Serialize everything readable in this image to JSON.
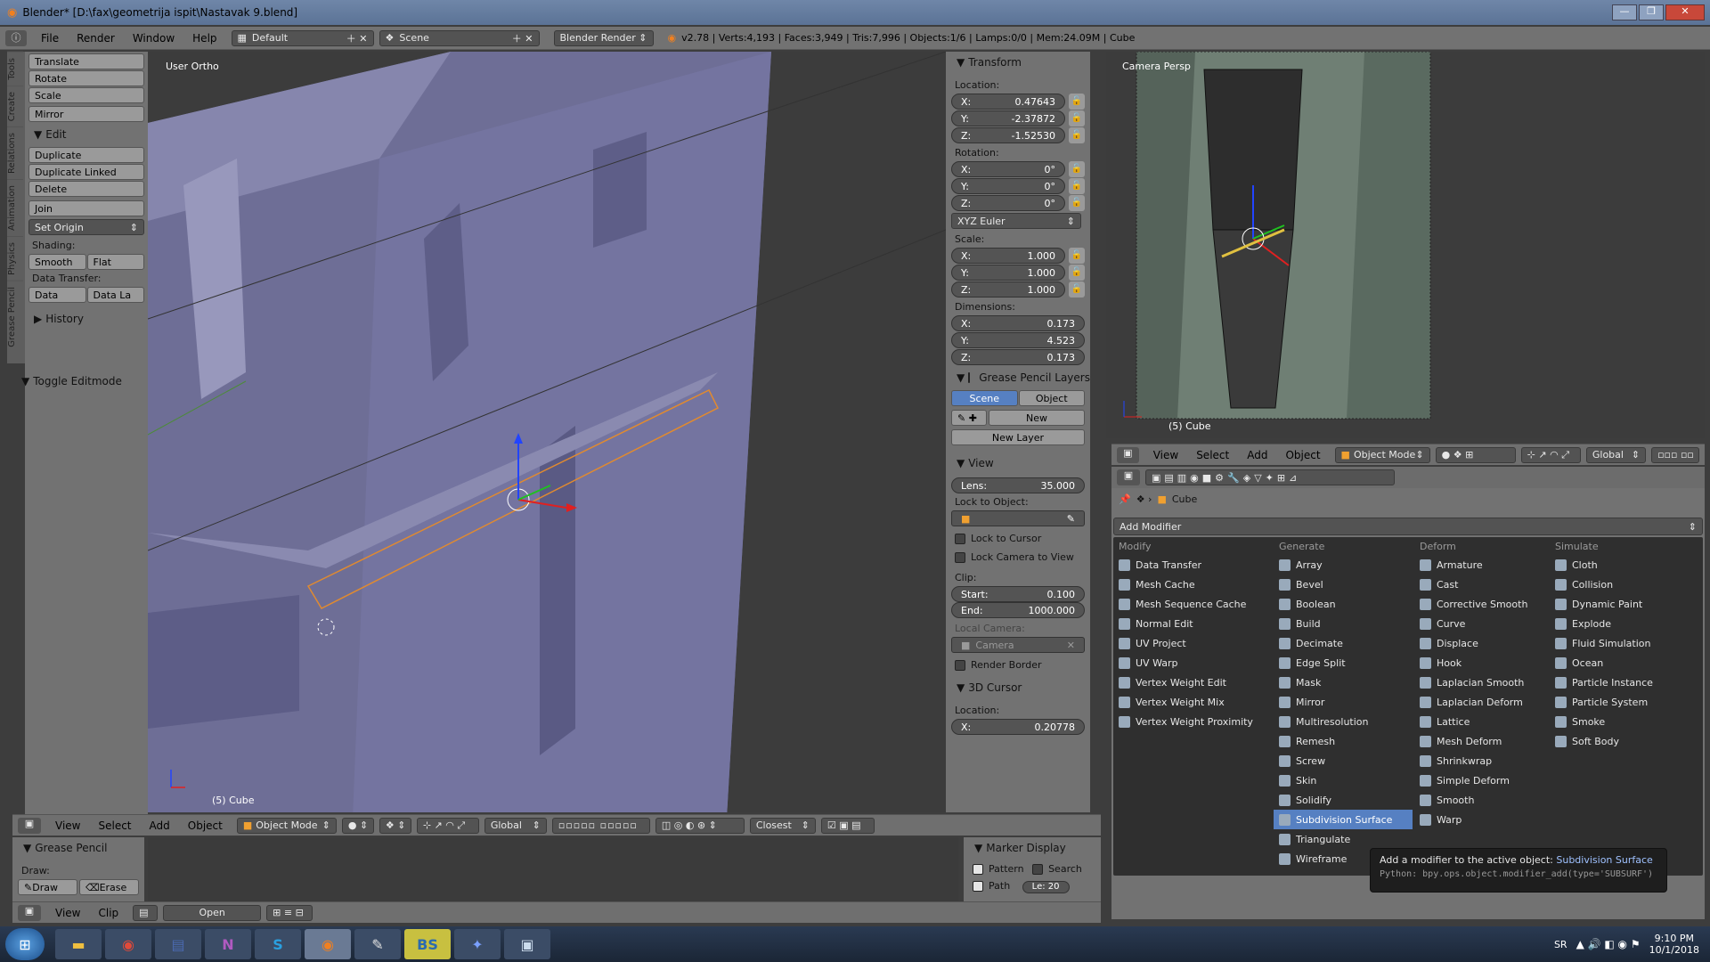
{
  "titlebar": {
    "title": "Blender* [D:\\fax\\geometrija ispit\\Nastavak 9.blend]",
    "min": "—",
    "max": "❐",
    "close": "✕"
  },
  "info": {
    "menus": [
      "File",
      "Render",
      "Window",
      "Help"
    ],
    "layout": "Default",
    "scene": "Scene",
    "engine": "Blender Render",
    "stats": "v2.78 | Verts:4,193 | Faces:3,949 | Tris:7,996 | Objects:1/6 | Lamps:0/0 | Mem:24.09M | Cube"
  },
  "tools": {
    "tabs": [
      "Tools",
      "Create",
      "Relations",
      "Animation",
      "Physics",
      "Grease Pencil"
    ],
    "transform": [
      "Translate",
      "Rotate",
      "Scale"
    ],
    "mirror": "Mirror",
    "edit_title": "Edit",
    "edit": [
      "Duplicate",
      "Duplicate Linked",
      "Delete"
    ],
    "join": "Join",
    "set_origin": "Set Origin",
    "shading_label": "Shading:",
    "smooth": "Smooth",
    "flat": "Flat",
    "data_transfer_label": "Data Transfer:",
    "data": "Data",
    "data_la": "Data La",
    "history": "History",
    "toggle_editmode": "Toggle Editmode"
  },
  "viewport": {
    "label": "User Ortho",
    "object_label": "(5) Cube"
  },
  "vp_header": {
    "menus": [
      "View",
      "Select",
      "Add",
      "Object"
    ],
    "mode": "Object Mode",
    "orientation": "Global",
    "snap": "Closest"
  },
  "props": {
    "transform": "Transform",
    "location": "Location:",
    "loc": [
      {
        "a": "X:",
        "v": "0.47643"
      },
      {
        "a": "Y:",
        "v": "-2.37872"
      },
      {
        "a": "Z:",
        "v": "-1.52530"
      }
    ],
    "rotation": "Rotation:",
    "rot": [
      {
        "a": "X:",
        "v": "0°"
      },
      {
        "a": "Y:",
        "v": "0°"
      },
      {
        "a": "Z:",
        "v": "0°"
      }
    ],
    "euler": "XYZ Euler",
    "scale": "Scale:",
    "scl": [
      {
        "a": "X:",
        "v": "1.000"
      },
      {
        "a": "Y:",
        "v": "1.000"
      },
      {
        "a": "Z:",
        "v": "1.000"
      }
    ],
    "dimensions": "Dimensions:",
    "dim": [
      {
        "a": "X:",
        "v": "0.173"
      },
      {
        "a": "Y:",
        "v": "4.523"
      },
      {
        "a": "Z:",
        "v": "0.173"
      }
    ],
    "gp_layers": "Grease Pencil Layers",
    "scene_btn": "Scene",
    "object_btn": "Object",
    "new_btn": "New",
    "new_layer": "New Layer",
    "view": "View",
    "lens_label": "Lens:",
    "lens": "35.000",
    "lock_obj": "Lock to Object:",
    "lock_cursor": "Lock to Cursor",
    "lock_camera": "Lock Camera to View",
    "clip": "Clip:",
    "start_label": "Start:",
    "start": "0.100",
    "end_label": "End:",
    "end": "1000.000",
    "local_camera": "Local Camera:",
    "camera": "Camera",
    "render_border": "Render Border",
    "cursor3d": "3D Cursor",
    "cur_location": "Location:",
    "cur_x_label": "X:",
    "cur_x": "0.20778"
  },
  "camview": {
    "label": "Camera Persp",
    "object_label": "(5) Cube"
  },
  "cam_header": {
    "menus": [
      "View",
      "Select",
      "Add",
      "Object"
    ],
    "mode": "Object Mode",
    "orientation": "Global"
  },
  "modifier": {
    "breadcrumb": "Cube",
    "add": "Add Modifier",
    "cols": [
      {
        "h": "Modify",
        "items": [
          "Data Transfer",
          "Mesh Cache",
          "Mesh Sequence Cache",
          "Normal Edit",
          "UV Project",
          "UV Warp",
          "Vertex Weight Edit",
          "Vertex Weight Mix",
          "Vertex Weight Proximity"
        ]
      },
      {
        "h": "Generate",
        "items": [
          "Array",
          "Bevel",
          "Boolean",
          "Build",
          "Decimate",
          "Edge Split",
          "Mask",
          "Mirror",
          "Multiresolution",
          "Remesh",
          "Screw",
          "Skin",
          "Solidify",
          "Subdivision Surface",
          "Triangulate",
          "Wireframe"
        ]
      },
      {
        "h": "Deform",
        "items": [
          "Armature",
          "Cast",
          "Corrective Smooth",
          "Curve",
          "Displace",
          "Hook",
          "Laplacian Smooth",
          "Laplacian Deform",
          "Lattice",
          "Mesh Deform",
          "Shrinkwrap",
          "Simple Deform",
          "Smooth",
          "Warp"
        ]
      },
      {
        "h": "Simulate",
        "items": [
          "Cloth",
          "Collision",
          "Dynamic Paint",
          "Explode",
          "Fluid Simulation",
          "Ocean",
          "Particle Instance",
          "Particle System",
          "Smoke",
          "Soft Body"
        ]
      }
    ],
    "selected": "Subdivision Surface",
    "tooltip_a": "Add a modifier to the active object:",
    "tooltip_b": "Subdivision Surface",
    "tooltip_py": "Python: bpy.ops.object.modifier_add(type='SUBSURF')"
  },
  "bottom": {
    "gp": "Grease Pencil",
    "draw": "Draw:",
    "draw_btn": "Draw",
    "erase_btn": "Erase",
    "marker": "Marker Display",
    "pattern": "Pattern",
    "search": "Search",
    "path": "Path",
    "le": "Le: 20",
    "menus": [
      "View",
      "Clip"
    ],
    "open": "Open"
  },
  "taskbar": {
    "lang": "SR",
    "time": "9:10 PM",
    "date": "10/1/2018"
  }
}
